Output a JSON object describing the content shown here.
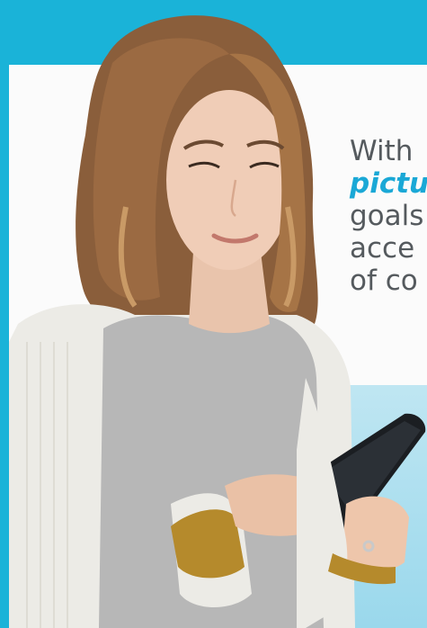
{
  "promo": {
    "line1": "With",
    "line2": "pictu",
    "line3": "goals",
    "line4": "acce",
    "line5": "of co"
  },
  "colors": {
    "border": "#1ab3d8",
    "accent_text": "#1aa8d6",
    "body_text": "#555a5e",
    "panel_bg": "#fbfbfb",
    "sweater": "#b7b7b7",
    "cardigan": "#ecebe6",
    "cuff": "#b58a2c",
    "phone": "#1b1e22"
  }
}
